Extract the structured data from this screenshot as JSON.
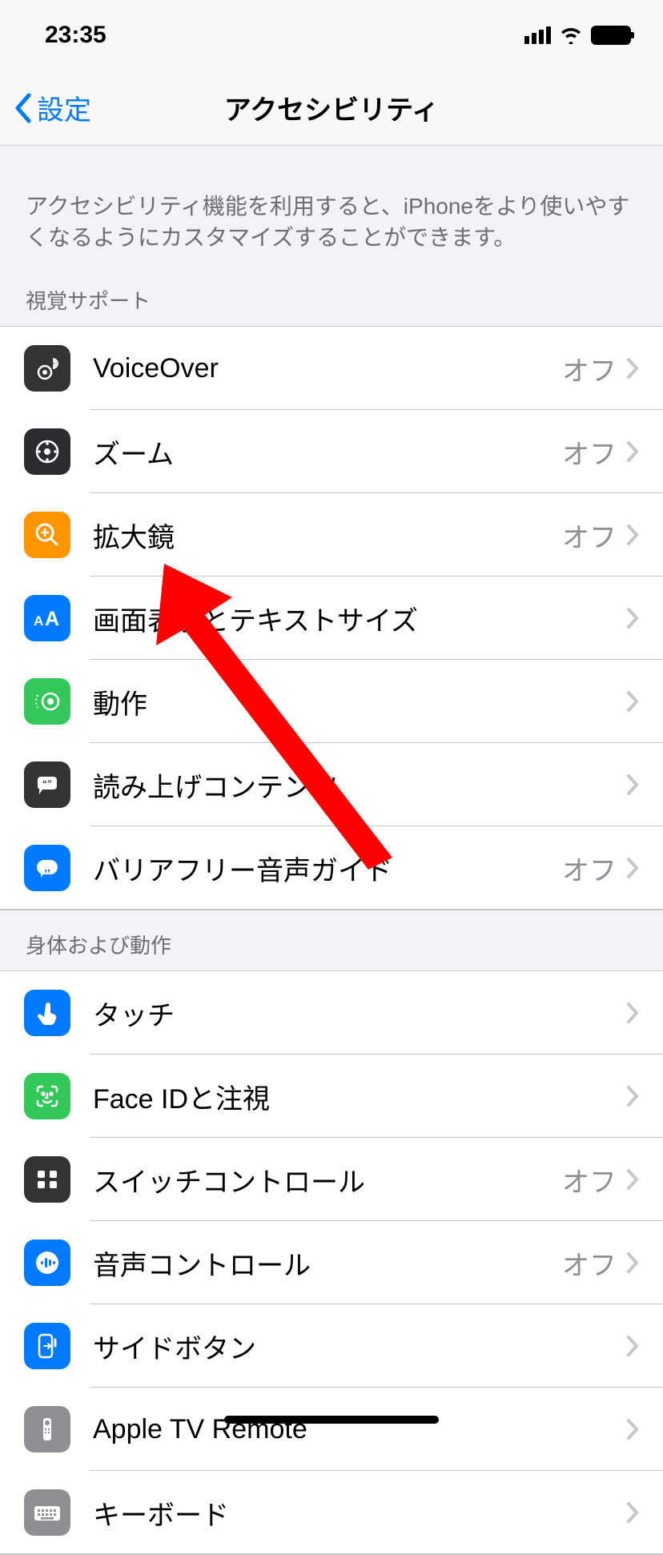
{
  "status": {
    "time": "23:35"
  },
  "nav": {
    "back": "設定",
    "title": "アクセシビリティ"
  },
  "intro": "アクセシビリティ機能を利用すると、iPhoneをより使いやすくなるようにカスタマイズすることができます。",
  "sections": [
    {
      "header": "視覚サポート",
      "items": [
        {
          "id": "voiceover",
          "label": "VoiceOver",
          "value": "オフ",
          "icon": "voiceover-icon",
          "color": "ic-black"
        },
        {
          "id": "zoom",
          "label": "ズーム",
          "value": "オフ",
          "icon": "zoom-icon",
          "color": "ic-black2"
        },
        {
          "id": "magnifier",
          "label": "拡大鏡",
          "value": "オフ",
          "icon": "magnifier-icon",
          "color": "ic-orange"
        },
        {
          "id": "display-text",
          "label": "画面表示とテキストサイズ",
          "value": "",
          "icon": "text-size-icon",
          "color": "ic-blue"
        },
        {
          "id": "motion",
          "label": "動作",
          "value": "",
          "icon": "motion-icon",
          "color": "ic-green"
        },
        {
          "id": "spoken-content",
          "label": "読み上げコンテンツ",
          "value": "",
          "icon": "speech-icon",
          "color": "ic-black"
        },
        {
          "id": "audio-descriptions",
          "label": "バリアフリー音声ガイド",
          "value": "オフ",
          "icon": "audio-desc-icon",
          "color": "ic-blue"
        }
      ]
    },
    {
      "header": "身体および動作",
      "items": [
        {
          "id": "touch",
          "label": "タッチ",
          "value": "",
          "icon": "touch-icon",
          "color": "ic-blue"
        },
        {
          "id": "faceid",
          "label": "Face IDと注視",
          "value": "",
          "icon": "faceid-icon",
          "color": "ic-green"
        },
        {
          "id": "switch-control",
          "label": "スイッチコントロール",
          "value": "オフ",
          "icon": "switch-icon",
          "color": "ic-black"
        },
        {
          "id": "voice-control",
          "label": "音声コントロール",
          "value": "オフ",
          "icon": "voice-control-icon",
          "color": "ic-blue"
        },
        {
          "id": "side-button",
          "label": "サイドボタン",
          "value": "",
          "icon": "side-button-icon",
          "color": "ic-blue"
        },
        {
          "id": "apple-tv-remote",
          "label": "Apple TV Remote",
          "value": "",
          "icon": "remote-icon",
          "color": "ic-gray"
        },
        {
          "id": "keyboard",
          "label": "キーボード",
          "value": "",
          "icon": "keyboard-icon",
          "color": "ic-gray"
        }
      ]
    }
  ]
}
